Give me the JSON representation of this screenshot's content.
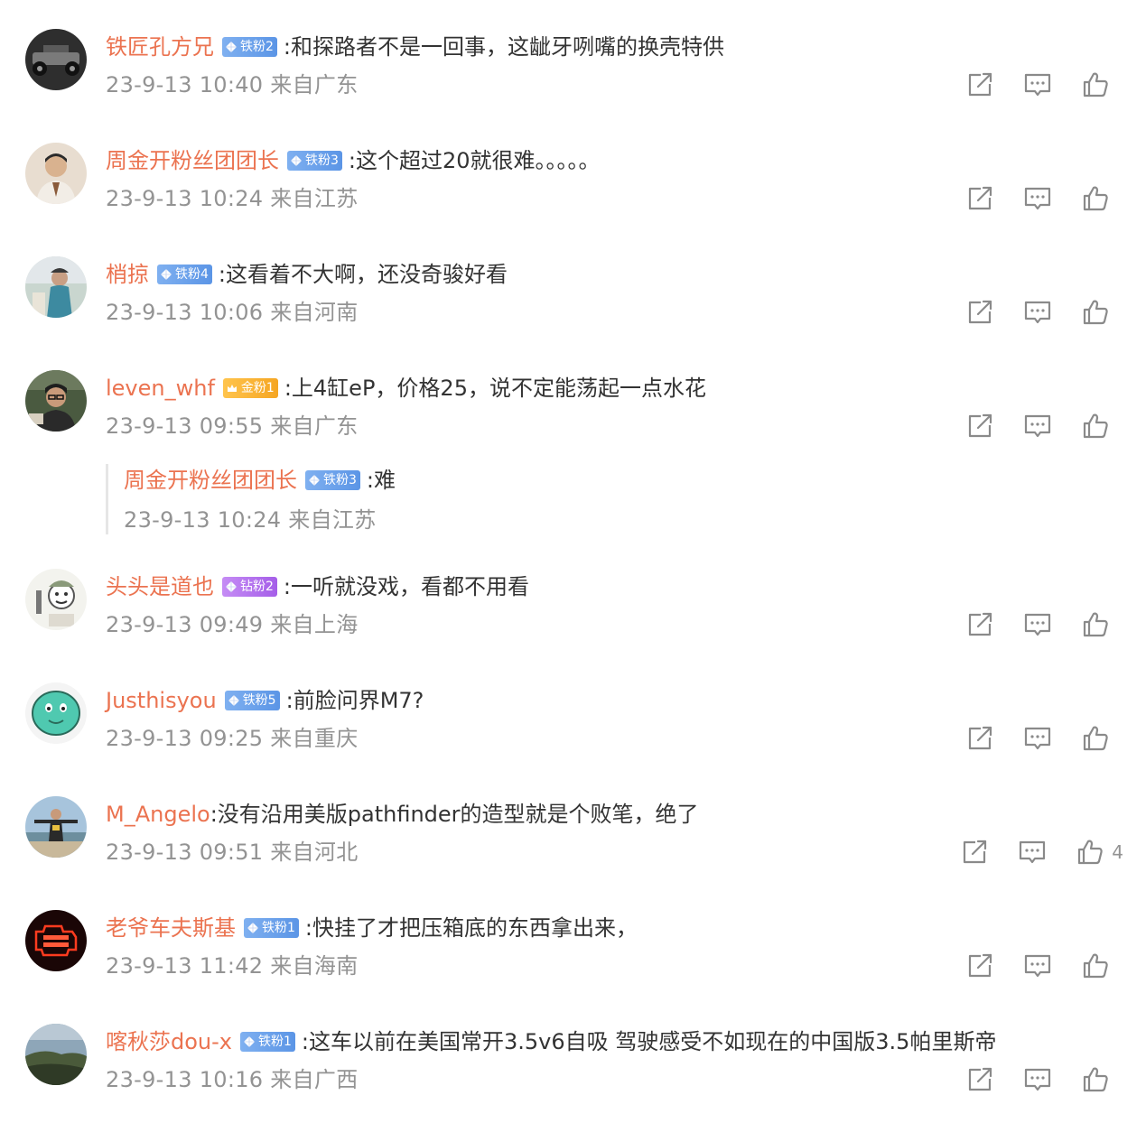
{
  "comments": [
    {
      "avatar": "car-chassis-avatar",
      "username": "铁匠孔方兄",
      "badge": {
        "type": "tie",
        "label": "铁粉2"
      },
      "text": ":和探路者不是一回事，这龇牙咧嘴的换壳特供",
      "meta": "23-9-13 10:40 来自广东"
    },
    {
      "avatar": "man-portrait-avatar",
      "username": "周金开粉丝团团长",
      "badge": {
        "type": "tie",
        "label": "铁粉3"
      },
      "text": ":这个超过20就很难。。。。。",
      "meta": "23-9-13 10:24 来自江苏"
    },
    {
      "avatar": "person-outdoor-avatar",
      "username": "梢掠",
      "badge": {
        "type": "tie",
        "label": "铁粉4"
      },
      "text": ":这看着不大啊，还没奇骏好看",
      "meta": "23-9-13 10:06 来自河南"
    },
    {
      "avatar": "man-glasses-avatar",
      "username": "leven_whf",
      "badge": {
        "type": "jin",
        "label": "金粉1"
      },
      "text": ":上4缸eP，价格25，说不定能荡起一点水花",
      "meta": "23-9-13 09:55 来自广东"
    },
    {
      "avatar": "meme-sketch-avatar",
      "username": "头头是道也",
      "badge": {
        "type": "zuan",
        "label": "钻粉2"
      },
      "text": ":一听就没戏，看都不用看",
      "meta": "23-9-13 09:49 来自上海"
    },
    {
      "avatar": "green-cartoon-avatar",
      "username": "Justhisyou",
      "badge": {
        "type": "tie",
        "label": "铁粉5"
      },
      "text": ":前脸问界M7?",
      "meta": "23-9-13 09:25 来自重庆"
    },
    {
      "avatar": "beach-person-avatar",
      "username": "M_Angelo",
      "badge": null,
      "text": ":没有沿用美版pathfinder的造型就是个败笔，绝了",
      "meta": "23-9-13 09:51 来自河北",
      "likes": "4"
    },
    {
      "avatar": "check-engine-avatar",
      "username": "老爷车夫斯基",
      "badge": {
        "type": "tie",
        "label": "铁粉1"
      },
      "text": ":快挂了才把压箱底的东西拿出来，",
      "meta": "23-9-13 11:42 来自海南"
    },
    {
      "avatar": "landscape-avatar",
      "username": "喀秋莎dou-x",
      "badge": {
        "type": "tie",
        "label": "铁粉1"
      },
      "text": ":这车以前在美国常开3.5v6自吸 驾驶感受不如现在的中国版3.5帕里斯帝",
      "meta": "23-9-13 10:16 来自广西"
    }
  ],
  "reply": {
    "username": "周金开粉丝团团长",
    "badge": {
      "type": "tie",
      "label": "铁粉3"
    },
    "text": ":难",
    "meta": "23-9-13 10:24 来自江苏"
  },
  "icons": {
    "share": "share-icon",
    "comment": "comment-icon",
    "like": "like-icon"
  },
  "colors": {
    "username": "#eb7350",
    "meta": "#939393",
    "text": "#333333",
    "icon": "#8a8a8a"
  }
}
